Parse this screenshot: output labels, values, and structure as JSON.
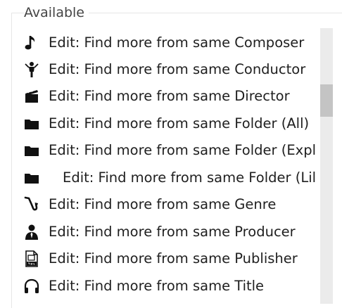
{
  "group": {
    "legend": "Available"
  },
  "items": [
    {
      "label": "Edit: Find more from same Composer",
      "icon": "music-note-icon"
    },
    {
      "label": "Edit: Find more from same Conductor",
      "icon": "conductor-icon"
    },
    {
      "label": "Edit: Find more from same Director",
      "icon": "clapperboard-icon"
    },
    {
      "label": "Edit: Find more from same Folder (All)",
      "icon": "folder-icon"
    },
    {
      "label": "Edit: Find more from same Folder (Expl",
      "icon": "folder-icon"
    },
    {
      "label": "Edit: Find more from same Folder (Lil",
      "icon": "folder-icon"
    },
    {
      "label": "Edit: Find more from same Genre",
      "icon": "saxophone-icon"
    },
    {
      "label": "Edit: Find more from same Producer",
      "icon": "producer-icon"
    },
    {
      "label": "Edit: Find more from same Publisher",
      "icon": "publisher-icon"
    },
    {
      "label": "Edit: Find more from same Title",
      "icon": "headphones-icon"
    }
  ]
}
